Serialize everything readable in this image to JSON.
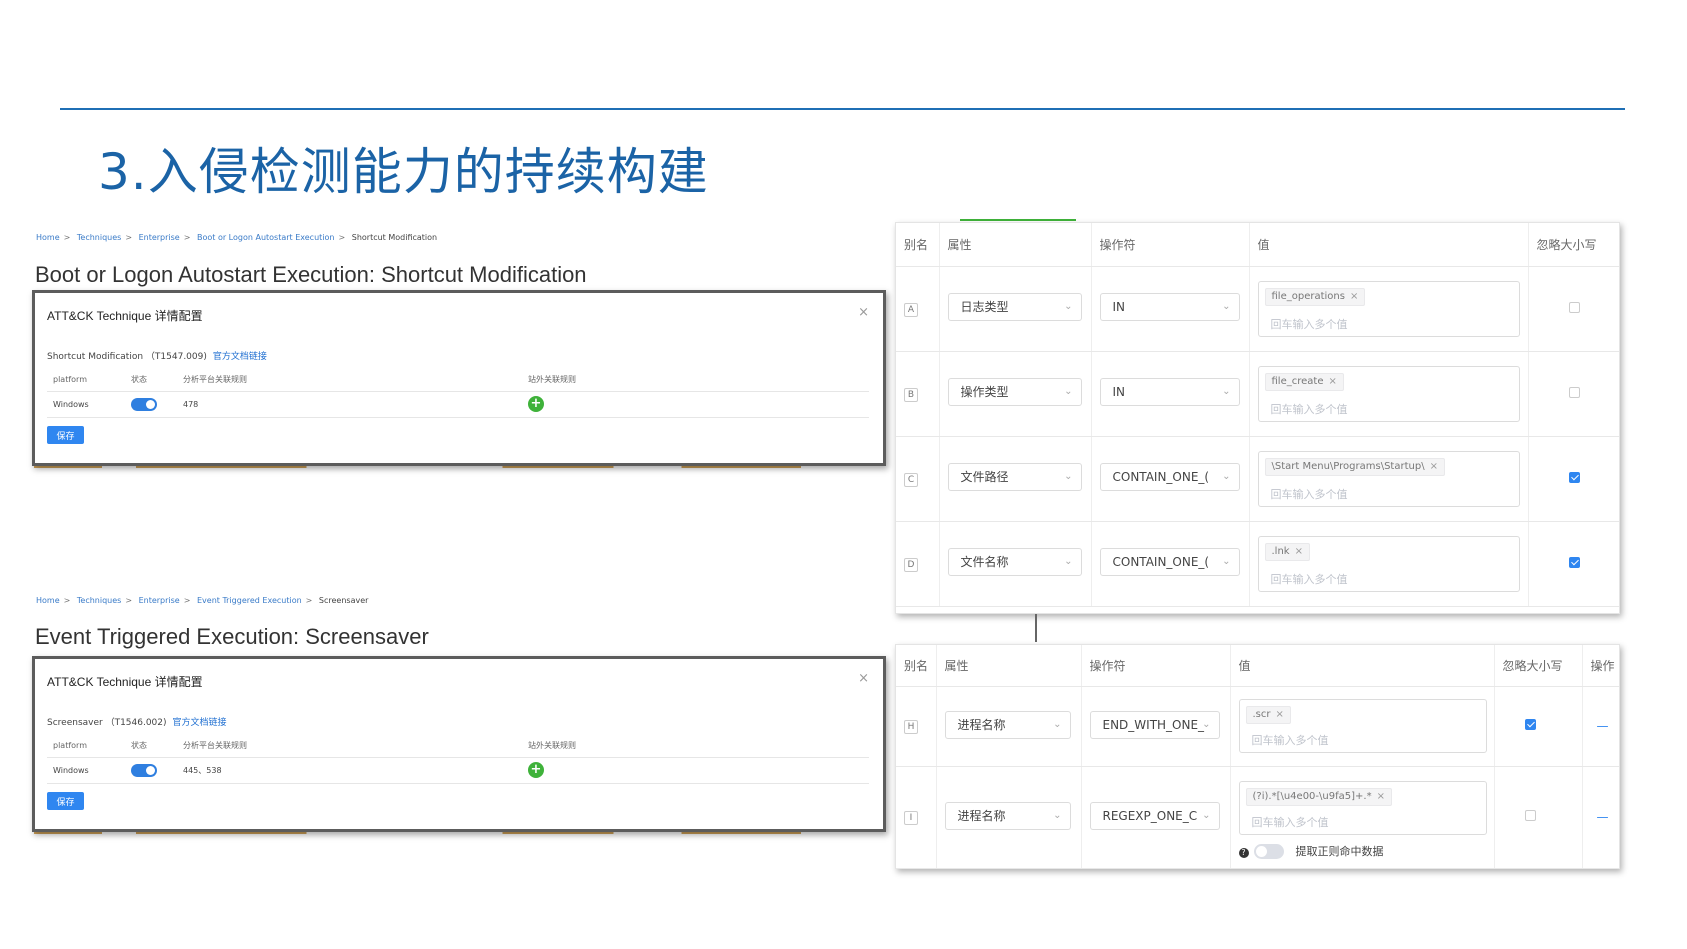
{
  "slide": {
    "title": "3.入侵检测能力的持续构建"
  },
  "panel1": {
    "breadcrumb": [
      "Home",
      "Techniques",
      "Enterprise",
      "Boot or Logon Autostart Execution",
      "Shortcut Modification"
    ],
    "heading": "Boot or Logon Autostart Execution: Shortcut Modification",
    "dialog_title": "ATT&CK Technique 详情配置",
    "close": "×",
    "technique": "Shortcut Modification （T1547.009)",
    "doc_link": "官方文档链接",
    "columns": [
      "platform",
      "状态",
      "分析平台关联规则",
      "站外关联规则"
    ],
    "row": {
      "platform": "Windows",
      "rules": "478"
    },
    "save": "保存"
  },
  "panel2": {
    "breadcrumb": [
      "Home",
      "Techniques",
      "Enterprise",
      "Event Triggered Execution",
      "Screensaver"
    ],
    "heading": "Event Triggered Execution: Screensaver",
    "dialog_title": "ATT&CK Technique 详情配置",
    "close": "×",
    "technique": "Screensaver （T1546.002)",
    "doc_link": "官方文档链接",
    "columns": [
      "platform",
      "状态",
      "分析平台关联规则",
      "站外关联规则"
    ],
    "row": {
      "platform": "Windows",
      "rules": "445、538"
    },
    "save": "保存"
  },
  "rules1": {
    "columns": [
      "别名",
      "属性",
      "操作符",
      "值",
      "忽略大小写"
    ],
    "placeholder": "回车输入多个值",
    "rows": [
      {
        "alias": "A",
        "attr": "日志类型",
        "op": "IN",
        "tag": "file_operations",
        "ignore_case": false
      },
      {
        "alias": "B",
        "attr": "操作类型",
        "op": "IN",
        "tag": "file_create",
        "ignore_case": false
      },
      {
        "alias": "C",
        "attr": "文件路径",
        "op": "CONTAIN_ONE_(",
        "tag": "\\Start Menu\\Programs\\Startup\\",
        "ignore_case": true
      },
      {
        "alias": "D",
        "attr": "文件名称",
        "op": "CONTAIN_ONE_(",
        "tag": ".lnk",
        "ignore_case": true
      }
    ]
  },
  "rules2": {
    "columns": [
      "别名",
      "属性",
      "操作符",
      "值",
      "忽略大小写",
      "操作"
    ],
    "placeholder": "回车输入多个值",
    "rows": [
      {
        "alias": "H",
        "attr": "进程名称",
        "op": "END_WITH_ONE_",
        "tag": ".scr",
        "ignore_case": true,
        "action": "—"
      },
      {
        "alias": "I",
        "attr": "进程名称",
        "op": "REGEXP_ONE_C",
        "tag": "(?i).*[\\u4e00-\\u9fa5]+.*",
        "ignore_case": false,
        "action": "—"
      }
    ],
    "regex_extract_label": "提取正则命中数据"
  },
  "icons": {
    "chevron": "chevron-down-icon",
    "close": "close-icon",
    "add": "plus-icon",
    "help": "help-icon"
  },
  "colors": {
    "title": "#1b63a6",
    "rule": "#1f6fb5",
    "primary": "#2f86f0",
    "add": "#3fb23a"
  }
}
